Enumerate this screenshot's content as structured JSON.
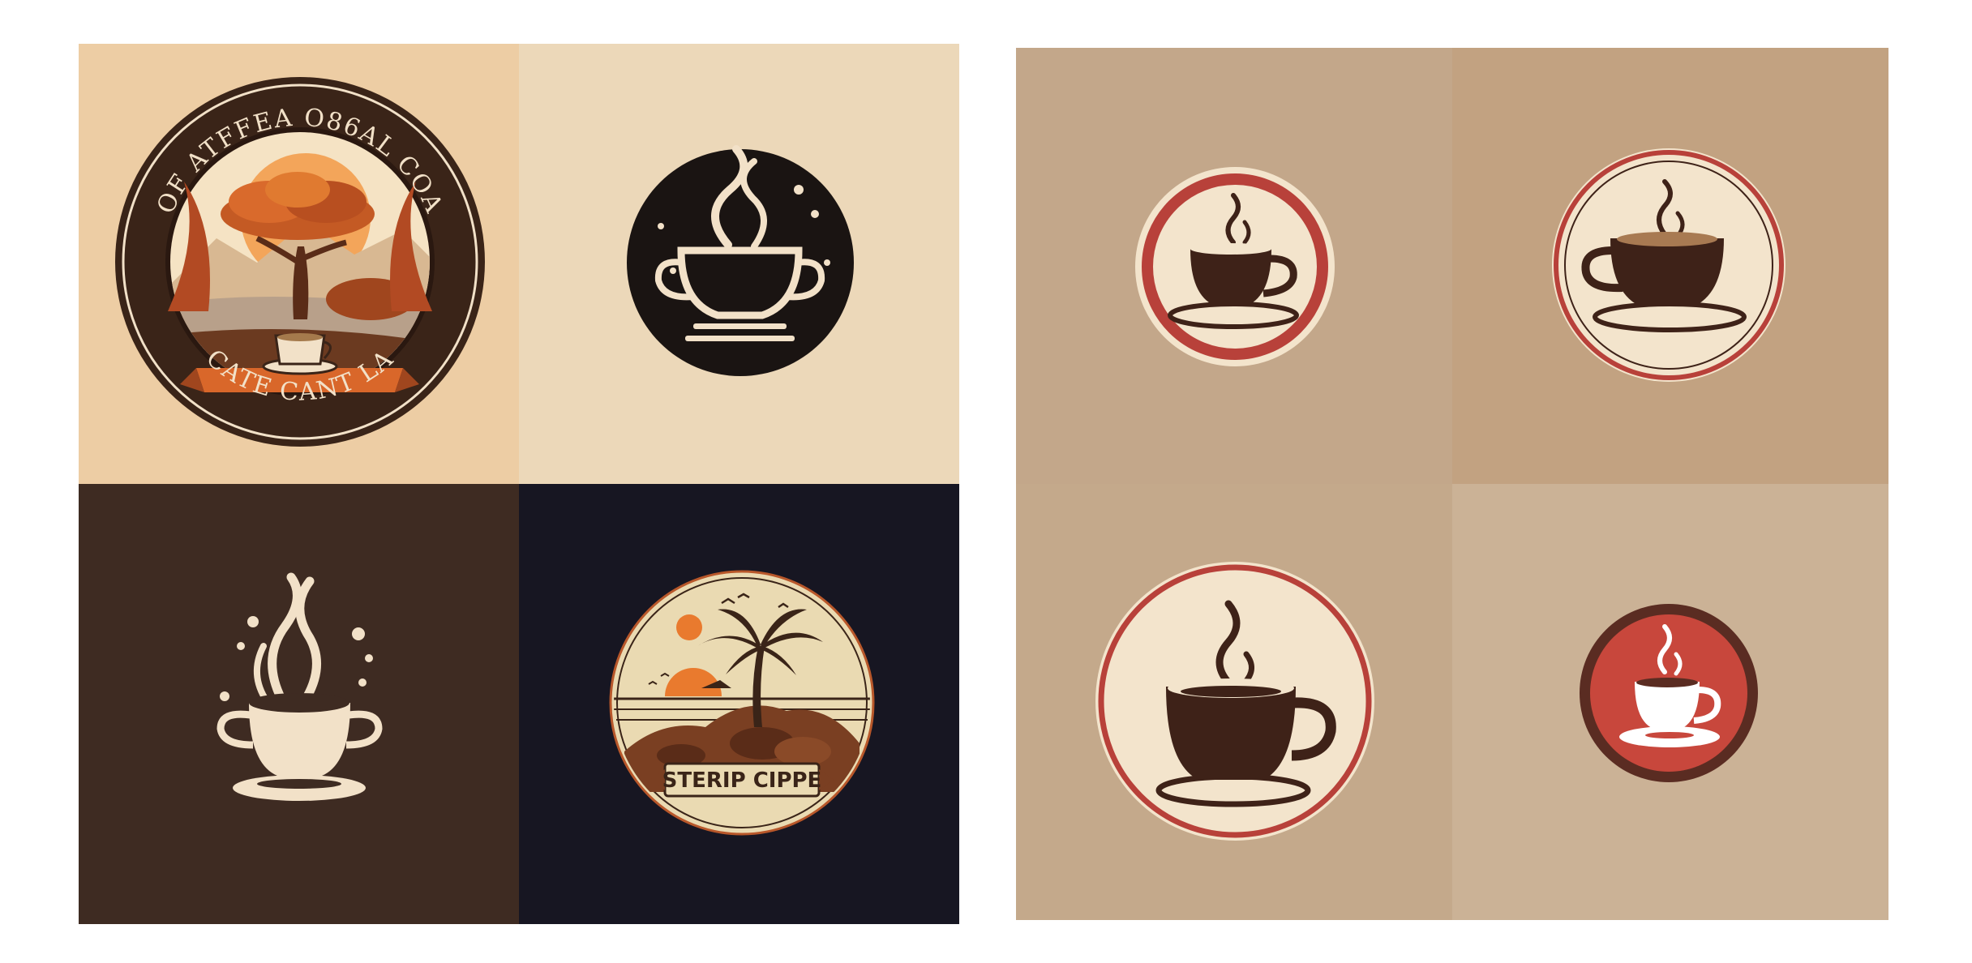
{
  "sheets": [
    {
      "tiles": [
        {
          "icon": "tree-landscape-coffee-badge-icon",
          "background": "#edcda4",
          "badge_text_top": "OF ATFFEA O86AL COA",
          "badge_text_bottom": "CATE CANT LA"
        },
        {
          "icon": "steaming-cup-circle-icon",
          "background": "#ecd8b9"
        },
        {
          "icon": "steaming-cup-icon",
          "background": "#3e2b22"
        },
        {
          "icon": "palm-island-sunset-badge-icon",
          "background": "#171622",
          "badge_text": "STERIP CIPPE"
        }
      ]
    },
    {
      "tiles": [
        {
          "icon": "red-ring-coffee-cup-icon",
          "background": "#c3a78a"
        },
        {
          "icon": "red-ring-coffee-cup-icon",
          "background": "#c2a281"
        },
        {
          "icon": "large-ring-coffee-cup-icon",
          "background": "#c4a98b"
        },
        {
          "icon": "red-disc-coffee-cup-icon",
          "background": "#cbb296"
        }
      ]
    }
  ],
  "colors": {
    "dark_brown": "#3e2218",
    "cream": "#f2e1c8",
    "orange": "#e07a2f",
    "rust": "#b24a23",
    "red": "#b8413a",
    "navy": "#171622",
    "white": "#ffffff"
  }
}
